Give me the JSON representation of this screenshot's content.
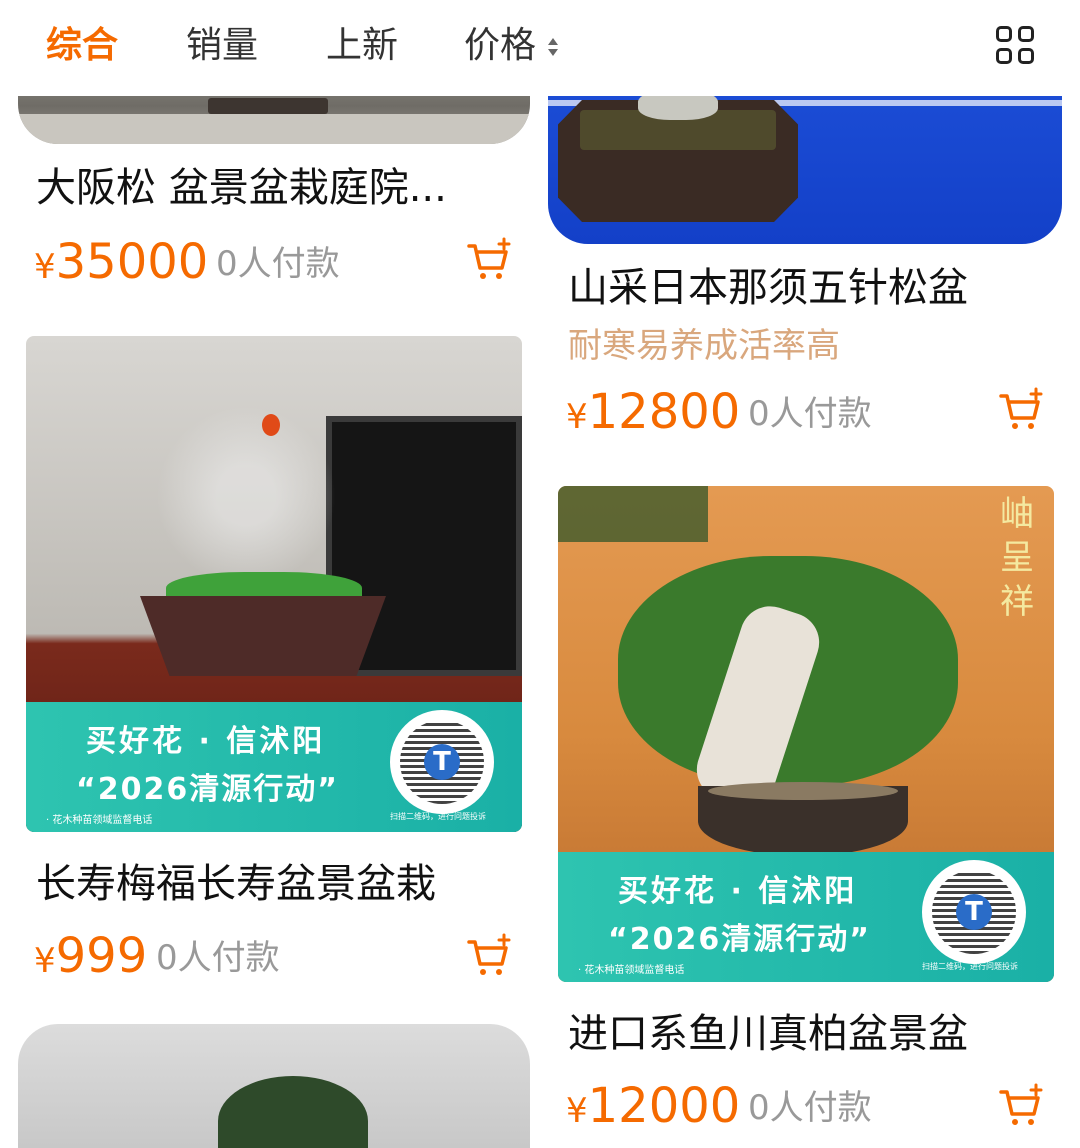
{
  "tabs": [
    {
      "label": "综合",
      "active": true
    },
    {
      "label": "销量",
      "active": false
    },
    {
      "label": "上新",
      "active": false
    },
    {
      "label": "价格",
      "active": false
    }
  ],
  "products": [
    {
      "title": "大阪松 盆景盆栽庭院...",
      "price": "35000",
      "currency": "¥",
      "paid": "0人付款"
    },
    {
      "title": "山采日本那须五针松盆",
      "subtitle": "耐寒易养成活率高",
      "price": "12800",
      "currency": "¥",
      "paid": "0人付款"
    },
    {
      "title": "长寿梅福长寿盆景盆栽",
      "price": "999",
      "currency": "¥",
      "paid": "0人付款",
      "banner": {
        "line1": "买好花 · 信沭阳",
        "line2": "“2026清源行动”",
        "note": "· 花木种苗领域监督电话",
        "qr_note": "扫描二维码，进行问题投诉"
      }
    },
    {
      "title": "进口系鱼川真柏盆景盆",
      "price": "12000",
      "currency": "¥",
      "paid": "0人付款",
      "image_text": "岫呈祥",
      "banner": {
        "line1": "买好花 · 信沭阳",
        "line2": "“2026清源行动”",
        "note": "· 花木种苗领域监督电话",
        "qr_note": "扫描二维码，进行问题投诉"
      }
    }
  ],
  "colors": {
    "accent": "#f56a00",
    "subtitle": "#d9a77d",
    "muted": "#999999"
  }
}
